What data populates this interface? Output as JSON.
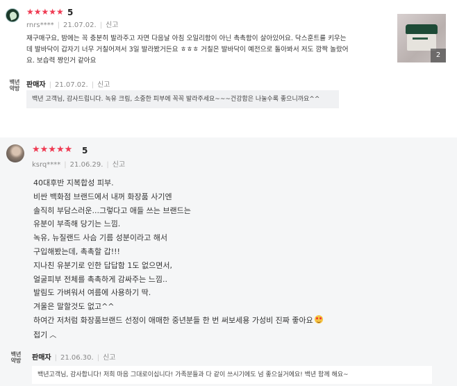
{
  "review1": {
    "stars": "★★★★★",
    "score": "5",
    "user": "rnrs****",
    "date": "21.07.02.",
    "report": "신고",
    "body_lines": [
      "재구매구요, 밤에는 꼭 충분히 발라주고 자면 다음날 아침 오일리함이 아닌 촉촉함이 살아있어요.  닥스훈트를 키우는",
      "데 발바닥이 갑자기 너무 거칠어져서 3일 발라봤거든요 ㅎㅎㅎ 거칠은 발바닥이 예전으로 돌아봐서 저도 깜짝 놀랐어",
      "요. 보습력 짱인거 같아요"
    ],
    "photo_count": "2",
    "seller": {
      "logo_line1": "백년",
      "logo_line2": "약방",
      "label": "판매자",
      "date": "21.07.02.",
      "report": "신고",
      "reply": "백년 고객님, 감사드립니다. 녹유 크림, 소중한 피부에 꼭꼭 발라주세요~~~건강함은 나눌수록 좋으니까요^^"
    }
  },
  "review2": {
    "stars": "★★★★★",
    "score": "5",
    "user": "ksrq****",
    "date": "21.06.29.",
    "report": "신고",
    "body_lines": [
      "40대후반  지복합성 피부.",
      "비싼 백화점 브랜드에서  내꺼 화장품 사기엔",
      "솔직히 부담스러운...그렇다고 애들 쓰는 브랜드는",
      "유분이 부족해 당기는 느낌.",
      "녹유, 뉴질랜드 사슴 기름 성분이라고 해서",
      "구입해봤는데, 촉촉할 갑!!!",
      "지나친 유분기로 인한 답답함 1도 없으면서,",
      "얼굴피부 전체를 촉촉하게 감싸주는 느낌..",
      "발림도 가벼워서 여름에 사용하기 딱.",
      "겨울은 말할것도 없고^^",
      "하여간 저처럼 화장품브랜드 선정이 애매한 중년분들 한 번 써보세용 가성비 진짜 좋아요"
    ],
    "collapse_label": "접기",
    "collapse_icon": "chevron-up-icon",
    "seller": {
      "logo_line1": "백년",
      "logo_line2": "약방",
      "label": "판매자",
      "date": "21.06.30.",
      "report": "신고",
      "reply": "백년고객님, 감사합니다! 저희 마음 그대로이십니다! 가족분들과 다 같이 쓰시기에도 넘 좋으실거에요! 백년 함께 해요~"
    }
  },
  "colors": {
    "star": "#ef3b53",
    "meta": "#888888",
    "reply_bg": "#f0f1f3"
  }
}
